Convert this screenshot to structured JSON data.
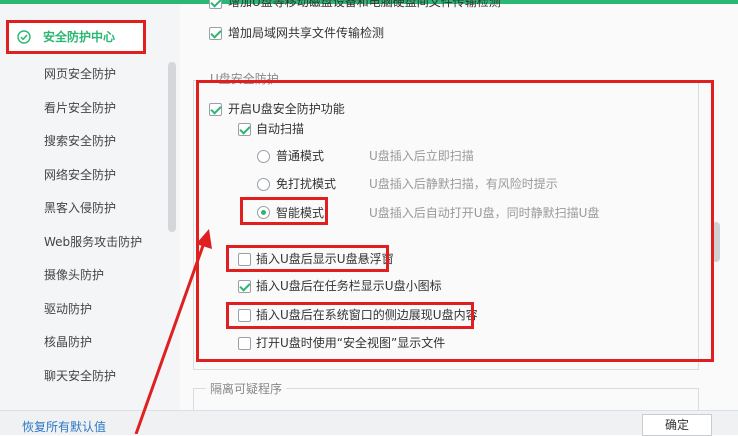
{
  "sidebar": {
    "active_item": "安全防护中心",
    "items": [
      {
        "label": "网页安全防护"
      },
      {
        "label": "看片安全防护"
      },
      {
        "label": "搜索安全防护"
      },
      {
        "label": "网络安全防护"
      },
      {
        "label": "黑客入侵防护"
      },
      {
        "label": "Web服务攻击防护"
      },
      {
        "label": "摄像头防护"
      },
      {
        "label": "驱动防护"
      },
      {
        "label": "核晶防护"
      },
      {
        "label": "聊天安全防护"
      }
    ],
    "reset_link": "恢复所有默认值"
  },
  "main": {
    "top_options": [
      {
        "label": "增加U盘等移动磁盘设备和电脑硬盘间文件传输检测",
        "checked": true
      },
      {
        "label": "增加局域网共享文件传输检测",
        "checked": true
      }
    ],
    "usb_group": {
      "title": "U盘安全防护",
      "enable": {
        "label": "开启U盘安全防护功能",
        "checked": true
      },
      "auto_scan": {
        "label": "自动扫描",
        "checked": true
      },
      "modes": [
        {
          "label": "普通模式",
          "desc": "U盘插入后立即扫描",
          "selected": false
        },
        {
          "label": "免打扰模式",
          "desc": "U盘插入后静默扫描，有风险时提示",
          "selected": false
        },
        {
          "label": "智能模式",
          "desc": "U盘插入后自动打开U盘，同时静默扫描U盘",
          "selected": true
        }
      ],
      "options": [
        {
          "label": "插入U盘后显示U盘悬浮窗",
          "checked": false
        },
        {
          "label": "插入U盘后在任务栏显示U盘小图标",
          "checked": true
        },
        {
          "label": "插入U盘后在系统窗口的侧边展现U盘内容",
          "checked": false
        },
        {
          "label": "打开U盘时使用“安全视图”显示文件",
          "checked": false
        }
      ]
    },
    "isolation_group": {
      "title": "隔离可疑程序"
    }
  },
  "footer": {
    "ok_label": "确定"
  },
  "colors": {
    "accent": "#2bb673",
    "annotation": "#e02020",
    "link": "#2b78c5"
  }
}
